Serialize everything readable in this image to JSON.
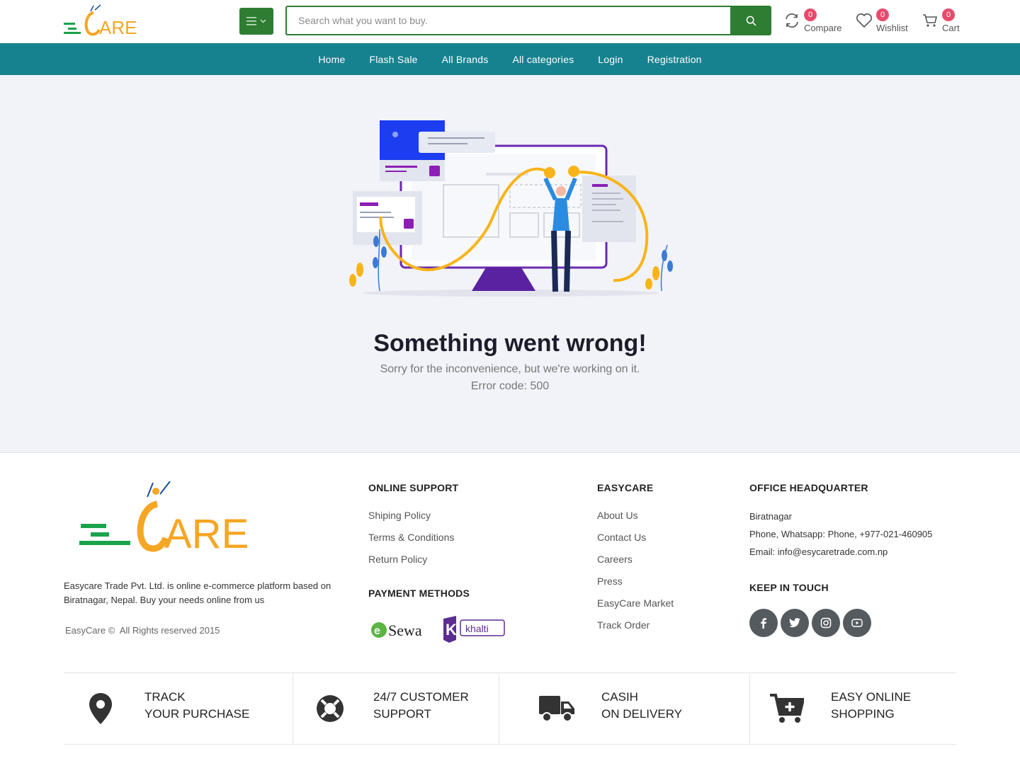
{
  "brand": {
    "logo_alt": "EasyCare logo"
  },
  "search": {
    "placeholder": "Search what you want to buy."
  },
  "header": {
    "compare": {
      "label": "Compare",
      "count": "0"
    },
    "wishlist": {
      "label": "Wishlist",
      "count": "0"
    },
    "cart": {
      "label": "Cart",
      "count": "0"
    }
  },
  "nav": {
    "items": [
      {
        "label": "Home"
      },
      {
        "label": "Flash Sale"
      },
      {
        "label": "All Brands"
      },
      {
        "label": "All categories"
      },
      {
        "label": "Login"
      },
      {
        "label": "Registration"
      }
    ]
  },
  "error": {
    "title": "Something went wrong!",
    "message": "Sorry for the inconvenience, but we're working on it.",
    "code_text": "Error code: 500"
  },
  "footer": {
    "about": "Easycare Trade Pvt. Ltd. is online e-commerce platform based on Biratnagar, Nepal. Buy your needs online from us",
    "copyright": "EasyCare ©  All Rights reserved 2015",
    "online_support": {
      "title": "ONLINE SUPPORT",
      "links": [
        "Shiping Policy",
        "Terms & Conditions",
        "Return Policy"
      ]
    },
    "payment": {
      "title": "PAYMENT METHODS",
      "methods": [
        "eSewa",
        "khalti"
      ]
    },
    "easycare": {
      "title": "EASYCARE",
      "links": [
        "About Us",
        "Contact Us",
        "Careers",
        "Press",
        "EasyCare Market",
        "Track Order"
      ]
    },
    "office": {
      "title": "OFFICE HEADQUARTER",
      "city": "Biratnagar",
      "phone": "Phone, Whatsapp: Phone, +977-021-460905",
      "email": "Email: info@esycaretrade.com.np"
    },
    "social": {
      "title": "KEEP IN TOUCH",
      "icons": [
        "facebook-icon",
        "twitter-icon",
        "instagram-icon",
        "youtube-icon"
      ]
    }
  },
  "features": [
    {
      "line1": "TRACK",
      "line2": "YOUR PURCHASE",
      "icon": "map-pin-icon"
    },
    {
      "line1": "24/7 CUSTOMER",
      "line2": "SUPPORT",
      "icon": "lifebuoy-icon"
    },
    {
      "line1": "CASIH",
      "line2": "ON DELIVERY",
      "icon": "truck-icon"
    },
    {
      "line1": "EASY ONLINE",
      "line2": "SHOPPING",
      "icon": "cart-plus-icon"
    }
  ],
  "colors": {
    "primary_green": "#2e7d32",
    "nav_teal": "#17828f",
    "badge_pink": "#e84a6b",
    "logo_orange": "#f5a623"
  }
}
